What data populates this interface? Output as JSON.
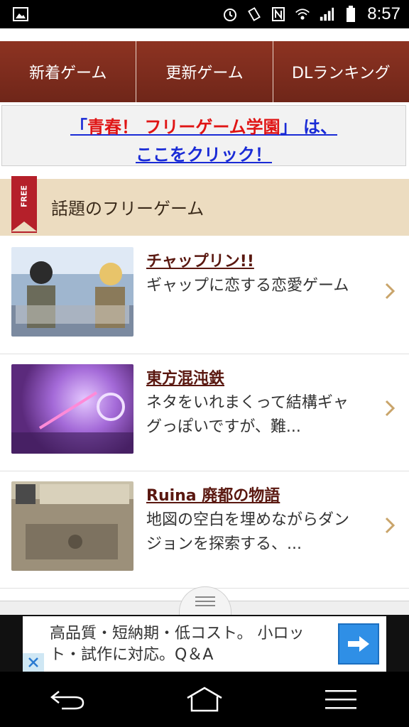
{
  "status_bar": {
    "time": "8:57",
    "icons": [
      "gallery-icon",
      "alarm-icon",
      "vibrate-icon",
      "nfc-icon",
      "wifi-icon",
      "signal-icon",
      "battery-icon"
    ]
  },
  "top_nav": {
    "items": [
      {
        "label": "新着ゲーム"
      },
      {
        "label": "更新ゲーム"
      },
      {
        "label": "DLランキング"
      }
    ]
  },
  "promo": {
    "line1_prefix": "「",
    "line1_highlight": "青春！ フリーゲーム学園",
    "line1_suffix": "」 は、",
    "line2": "ここをクリック！"
  },
  "section": {
    "ribbon_label": "FREE",
    "title": "話題のフリーゲーム"
  },
  "games": [
    {
      "title": "チャップリン!!",
      "description": "ギャップに恋する恋愛ゲーム"
    },
    {
      "title": "東方混沌鉄",
      "description": "ネタをいれまくって結構ギャグっぽいですが、難..."
    },
    {
      "title": "Ruina 廃都の物語",
      "description": "地図の空白を埋めながらダンジョンを探索する、..."
    }
  ],
  "ad": {
    "text": "高品質・短納期・低コスト。 小ロット・試作に対応。Q＆A"
  },
  "colors": {
    "nav_bg": "#7a2a1c",
    "section_bg": "#ecdcc0",
    "ribbon": "#b5202a",
    "link_blue": "#1a2bd6",
    "link_red": "#e01515",
    "title_color": "#5a1810",
    "chevron": "#c9a46a",
    "ad_button": "#2f8fe6"
  }
}
